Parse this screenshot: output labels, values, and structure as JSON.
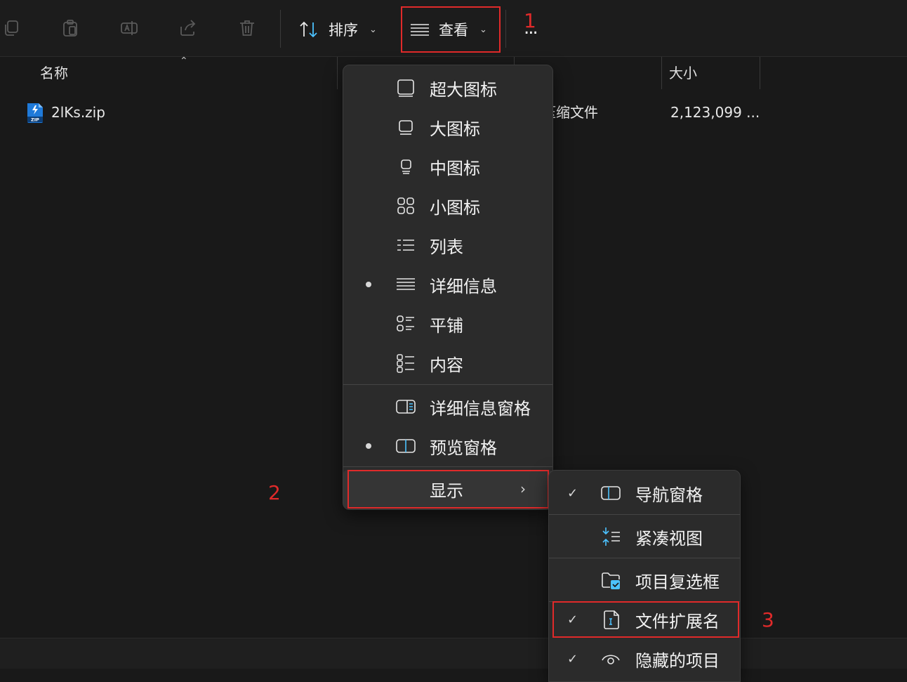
{
  "colors": {
    "accent": "#4cc2ff",
    "annotation": "#e02a2a",
    "menu_bg": "#2b2b2b"
  },
  "toolbar": {
    "icon_buttons": [
      "copy-icon",
      "paste-icon",
      "rename-icon",
      "share-icon",
      "delete-icon"
    ],
    "sort_label": "排序",
    "view_label": "查看",
    "more_label": "..."
  },
  "annotations": {
    "a1": "1",
    "a2": "2",
    "a3": "3"
  },
  "columns": {
    "name": "名称",
    "size": "大小"
  },
  "files": [
    {
      "name": "2lKs.zip",
      "type": "压缩文件",
      "size": "2,123,099 ..."
    }
  ],
  "view_menu": {
    "items": [
      {
        "label": "超大图标",
        "icon": "extra-large-icons-icon",
        "selected": false
      },
      {
        "label": "大图标",
        "icon": "large-icons-icon",
        "selected": false
      },
      {
        "label": "中图标",
        "icon": "medium-icons-icon",
        "selected": false
      },
      {
        "label": "小图标",
        "icon": "small-icons-icon",
        "selected": false
      },
      {
        "label": "列表",
        "icon": "list-icon",
        "selected": false
      },
      {
        "label": "详细信息",
        "icon": "details-icon",
        "selected": true
      },
      {
        "label": "平铺",
        "icon": "tiles-icon",
        "selected": false
      },
      {
        "label": "内容",
        "icon": "content-icon",
        "selected": false
      }
    ],
    "panes": [
      {
        "label": "详细信息窗格",
        "icon": "details-pane-icon",
        "selected": false
      },
      {
        "label": "预览窗格",
        "icon": "preview-pane-icon",
        "selected": true
      }
    ],
    "show_label": "显示"
  },
  "show_submenu": {
    "items": [
      {
        "label": "导航窗格",
        "icon": "navigation-pane-icon",
        "checked": true
      },
      {
        "label": "紧凑视图",
        "icon": "compact-view-icon",
        "checked": false
      },
      {
        "label": "项目复选框",
        "icon": "item-checkboxes-icon",
        "checked": false
      },
      {
        "label": "文件扩展名",
        "icon": "file-extension-icon",
        "checked": true
      },
      {
        "label": "隐藏的项目",
        "icon": "hidden-items-icon",
        "checked": true
      }
    ]
  }
}
